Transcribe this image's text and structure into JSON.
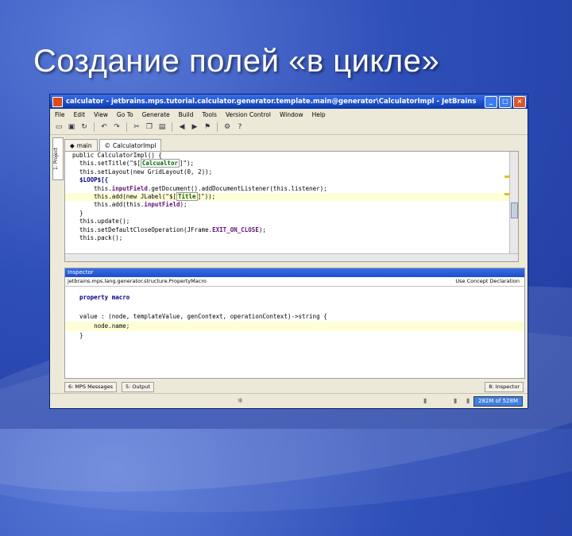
{
  "slide": {
    "title": "Создание полей «в цикле»"
  },
  "window": {
    "title": "calculator - jetbrains.mps.tutorial.calculator.generator.template.main@generator\\CalculatorImpl - JetBrains M...",
    "controls": [
      "_",
      "□",
      "×"
    ]
  },
  "menu": [
    "File",
    "Edit",
    "View",
    "Go To",
    "Generate",
    "Build",
    "Tools",
    "Version Control",
    "Window",
    "Help"
  ],
  "editor": {
    "tabs": [
      {
        "label": "main",
        "icon": "model-icon"
      },
      {
        "label": "CalculatorImpl",
        "icon": "class-icon"
      }
    ],
    "code": [
      {
        "text": "  public CalculatorImpl() {"
      },
      {
        "pre": "    this.setTitle(\"$[",
        "macro": "Calcualtor",
        "post": "]\");"
      },
      {
        "text": "    this.setLayout(new GridLayout(0, 2));"
      },
      {
        "text": "    $LOOP$[{"
      },
      {
        "pre": "        this.",
        "field": "inputField",
        "post": ".getDocument().addDocumentListener(this.listener);"
      },
      {
        "pre": "        this.add(new JLabel(\"$[",
        "macro": "Title",
        "post": "]\"));",
        "highlight": true
      },
      {
        "pre": "        this.add(this.",
        "field": "inputField",
        "post": ");"
      },
      {
        "text": "    }"
      },
      {
        "text": "    this.update();"
      },
      {
        "pre": "    this.setDefaultCloseOperation(JFrame.",
        "field": "EXIT_ON_CLOSE",
        "post": ");"
      },
      {
        "text": "    this.pack();"
      }
    ]
  },
  "inspector": {
    "header": "Inspector",
    "path": "jetbrains.mps.lang.generator.structure.PropertyMacro",
    "concept": "Use Concept Declaration",
    "code": [
      {
        "text": "    property macro",
        "bold": true
      },
      {
        "text": ""
      },
      {
        "text": "    value : (node, templateValue, genContext, operationContext)->string {"
      },
      {
        "text": "        node.name;",
        "highlight": true
      },
      {
        "text": "    }"
      }
    ]
  },
  "bottom_tabs": {
    "left": [
      "6: MPS Messages",
      "5: Output"
    ],
    "right": "8: Inspector"
  },
  "status": {
    "memory": "282M of 528M"
  },
  "colors": {
    "titlebar": "#1c4fc8",
    "highlight_line": "#ffffd7",
    "keyword": "#000080",
    "macro": "#006400"
  }
}
